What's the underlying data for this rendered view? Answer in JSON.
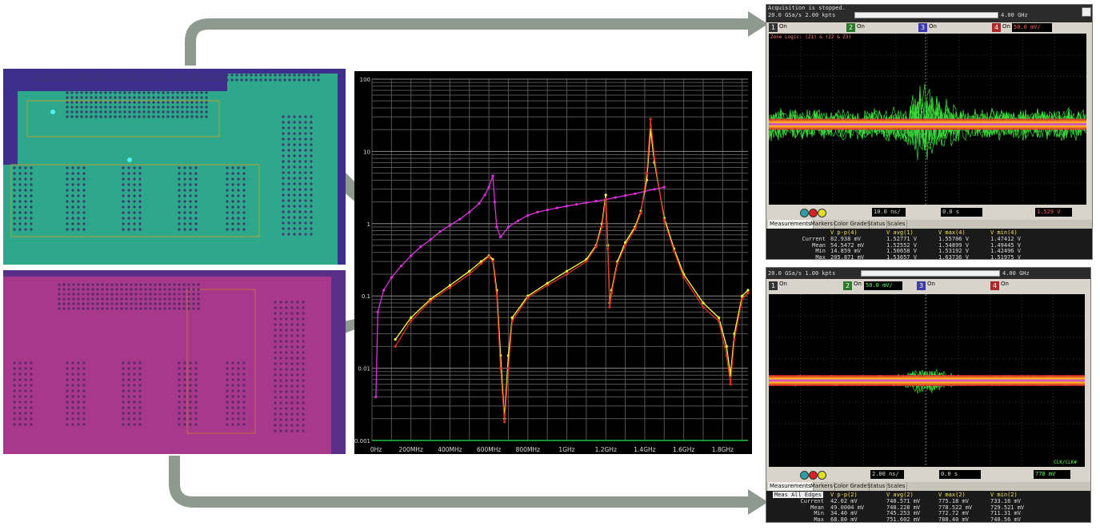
{
  "chart_data": {
    "type": "line",
    "xlabel": "",
    "ylabel": "",
    "x_ticks": [
      "0Hz",
      "200MHz",
      "400MHz",
      "600MHz",
      "800MHz",
      "1GHz",
      "1.2GHz",
      "1.4GHz",
      "1.6GHz",
      "1.8GHz"
    ],
    "y_ticks": [
      "0.001",
      "0.01",
      "0.1",
      "1",
      "10",
      "100"
    ],
    "x_range": [
      0,
      1.93
    ],
    "y_range_log10": [
      -3,
      2
    ],
    "scale_y": "log",
    "grid": true,
    "series": [
      {
        "color": "#e030e0",
        "points": [
          [
            0.02,
            0.004
          ],
          [
            0.03,
            0.06
          ],
          [
            0.06,
            0.12
          ],
          [
            0.1,
            0.18
          ],
          [
            0.15,
            0.26
          ],
          [
            0.2,
            0.36
          ],
          [
            0.25,
            0.48
          ],
          [
            0.3,
            0.6
          ],
          [
            0.35,
            0.78
          ],
          [
            0.4,
            0.95
          ],
          [
            0.45,
            1.15
          ],
          [
            0.5,
            1.45
          ],
          [
            0.55,
            1.9
          ],
          [
            0.58,
            2.5
          ],
          [
            0.6,
            3.2
          ],
          [
            0.62,
            4.6
          ],
          [
            0.63,
            2.0
          ],
          [
            0.64,
            0.9
          ],
          [
            0.66,
            0.65
          ],
          [
            0.7,
            0.9
          ],
          [
            0.75,
            1.1
          ],
          [
            0.8,
            1.3
          ],
          [
            0.85,
            1.45
          ],
          [
            0.9,
            1.55
          ],
          [
            0.95,
            1.65
          ],
          [
            1.0,
            1.75
          ],
          [
            1.05,
            1.85
          ],
          [
            1.1,
            1.95
          ],
          [
            1.15,
            2.05
          ],
          [
            1.2,
            2.15
          ],
          [
            1.25,
            2.3
          ],
          [
            1.3,
            2.45
          ],
          [
            1.35,
            2.6
          ],
          [
            1.4,
            2.8
          ],
          [
            1.45,
            3.0
          ],
          [
            1.5,
            3.2
          ]
        ]
      },
      {
        "color": "#ffff40",
        "points": [
          [
            0.12,
            0.025
          ],
          [
            0.2,
            0.05
          ],
          [
            0.3,
            0.09
          ],
          [
            0.4,
            0.14
          ],
          [
            0.5,
            0.22
          ],
          [
            0.56,
            0.3
          ],
          [
            0.6,
            0.36
          ],
          [
            0.62,
            0.32
          ],
          [
            0.64,
            0.12
          ],
          [
            0.66,
            0.015
          ],
          [
            0.68,
            0.002
          ],
          [
            0.7,
            0.015
          ],
          [
            0.72,
            0.05
          ],
          [
            0.8,
            0.1
          ],
          [
            0.9,
            0.15
          ],
          [
            1.0,
            0.22
          ],
          [
            1.1,
            0.32
          ],
          [
            1.15,
            0.5
          ],
          [
            1.18,
            1.0
          ],
          [
            1.2,
            2.5
          ],
          [
            1.21,
            0.5
          ],
          [
            1.22,
            0.08
          ],
          [
            1.23,
            0.12
          ],
          [
            1.26,
            0.3
          ],
          [
            1.3,
            0.55
          ],
          [
            1.35,
            0.9
          ],
          [
            1.38,
            1.5
          ],
          [
            1.41,
            4.0
          ],
          [
            1.43,
            20
          ],
          [
            1.45,
            7.0
          ],
          [
            1.5,
            1.2
          ],
          [
            1.55,
            0.45
          ],
          [
            1.6,
            0.2
          ],
          [
            1.7,
            0.08
          ],
          [
            1.78,
            0.05
          ],
          [
            1.82,
            0.02
          ],
          [
            1.84,
            0.008
          ],
          [
            1.86,
            0.03
          ],
          [
            1.9,
            0.1
          ],
          [
            1.93,
            0.12
          ]
        ]
      },
      {
        "color": "#e03020",
        "points": [
          [
            0.12,
            0.02
          ],
          [
            0.2,
            0.045
          ],
          [
            0.3,
            0.085
          ],
          [
            0.4,
            0.13
          ],
          [
            0.5,
            0.2
          ],
          [
            0.56,
            0.28
          ],
          [
            0.6,
            0.35
          ],
          [
            0.62,
            0.3
          ],
          [
            0.64,
            0.1
          ],
          [
            0.66,
            0.01
          ],
          [
            0.68,
            0.0018
          ],
          [
            0.7,
            0.01
          ],
          [
            0.72,
            0.045
          ],
          [
            0.8,
            0.095
          ],
          [
            0.9,
            0.14
          ],
          [
            1.0,
            0.2
          ],
          [
            1.1,
            0.3
          ],
          [
            1.15,
            0.48
          ],
          [
            1.18,
            0.9
          ],
          [
            1.2,
            2.2
          ],
          [
            1.21,
            0.45
          ],
          [
            1.22,
            0.07
          ],
          [
            1.23,
            0.11
          ],
          [
            1.26,
            0.28
          ],
          [
            1.3,
            0.5
          ],
          [
            1.35,
            0.85
          ],
          [
            1.38,
            1.4
          ],
          [
            1.41,
            5.0
          ],
          [
            1.43,
            28
          ],
          [
            1.45,
            8.0
          ],
          [
            1.5,
            1.1
          ],
          [
            1.55,
            0.42
          ],
          [
            1.6,
            0.18
          ],
          [
            1.7,
            0.07
          ],
          [
            1.78,
            0.045
          ],
          [
            1.82,
            0.015
          ],
          [
            1.84,
            0.006
          ],
          [
            1.86,
            0.025
          ],
          [
            1.9,
            0.09
          ],
          [
            1.93,
            0.11
          ]
        ]
      }
    ]
  },
  "scope_top": {
    "status": "Acquisition is stopped.",
    "rate": "20.0 GSa/s   2.00 kpts",
    "bandwidth": "4.00 GHz",
    "channels": [
      {
        "num": "1",
        "state": "On",
        "color": "#e8e8e8"
      },
      {
        "num": "2",
        "state": "On",
        "color": "#3a9a3a"
      },
      {
        "num": "3",
        "state": "On",
        "color": "#5a5aff"
      },
      {
        "num": "4",
        "state": "On",
        "color": "#ff4040"
      }
    ],
    "ch4_scale": "50.0 mV/",
    "zone_logic": "Zone Logic: (Z1) & (Z2 & Z3)",
    "timebase": "10.0 ns/",
    "delay": "0.0 s",
    "trigger_level": "1.529 V",
    "tabs": [
      "Measurements",
      "Markers",
      "Color Grade",
      "Status",
      "Scales"
    ],
    "headers": [
      "V p-p(4)",
      "V avg(1)",
      "V max(4)",
      "V min(4)"
    ],
    "rows": [
      {
        "label": "Current",
        "values": [
          "82.938 mV",
          "1.52771 V",
          "1.55706 V",
          "1.47412 V"
        ]
      },
      {
        "label": "Mean",
        "values": [
          "54.5472 mV",
          "1.52552 V",
          "1.54899 V",
          "1.49445 V"
        ]
      },
      {
        "label": "Min",
        "values": [
          "14.859 mV",
          "1.50658 V",
          "1.53192 V",
          "1.42496 V"
        ]
      },
      {
        "label": "Max",
        "values": [
          "205.871 mV",
          "1.53657 V",
          "1.63736 V",
          "1.51975 V"
        ]
      }
    ]
  },
  "scope_bottom": {
    "rate": "20.0 GSa/s   1.00 kpts",
    "bandwidth": "4.00 GHz",
    "channels": [
      {
        "num": "1",
        "state": "On",
        "color": "#e8e8e8"
      },
      {
        "num": "2",
        "state": "On",
        "color": "#3a9a3a"
      },
      {
        "num": "3",
        "state": "On",
        "color": "#5a5aff"
      },
      {
        "num": "4",
        "state": "On",
        "color": "#ff4040"
      }
    ],
    "ch2_scale": "50.0 mV/",
    "clk_label": "CLK/CLK#",
    "timebase": "2.00 ns/",
    "delay": "0.0 s",
    "trigger_level": "770 mV",
    "tabs": [
      "Measurements",
      "Markers",
      "Color Grade",
      "Status",
      "Scales"
    ],
    "meas_mode": "Meas All Edges",
    "headers": [
      "V p-p(2)",
      "V avg(2)",
      "V max(2)",
      "V min(2)"
    ],
    "rows": [
      {
        "label": "Current",
        "values": [
          "42.02 mV",
          "748.571 mV",
          "775.18 mV",
          "733.16 mV"
        ]
      },
      {
        "label": "Mean",
        "values": [
          "49.0004 mV",
          "748.228 mV",
          "778.522 mV",
          "729.521 mV"
        ]
      },
      {
        "label": "Min",
        "values": [
          "34.40 mV",
          "745.253 mV",
          "772.72 mV",
          "711.31 mV"
        ]
      },
      {
        "label": "Max",
        "values": [
          "68.80 mV",
          "751.602 mV",
          "788.40 mV",
          "740.56 mV"
        ]
      }
    ]
  },
  "colors": {
    "arrow": "#8e9a8e",
    "pcb_top_fill": "#2ea88a",
    "pcb_bottom_fill": "#a8388a",
    "grid": "#555555",
    "trace_green": "#40e040"
  }
}
